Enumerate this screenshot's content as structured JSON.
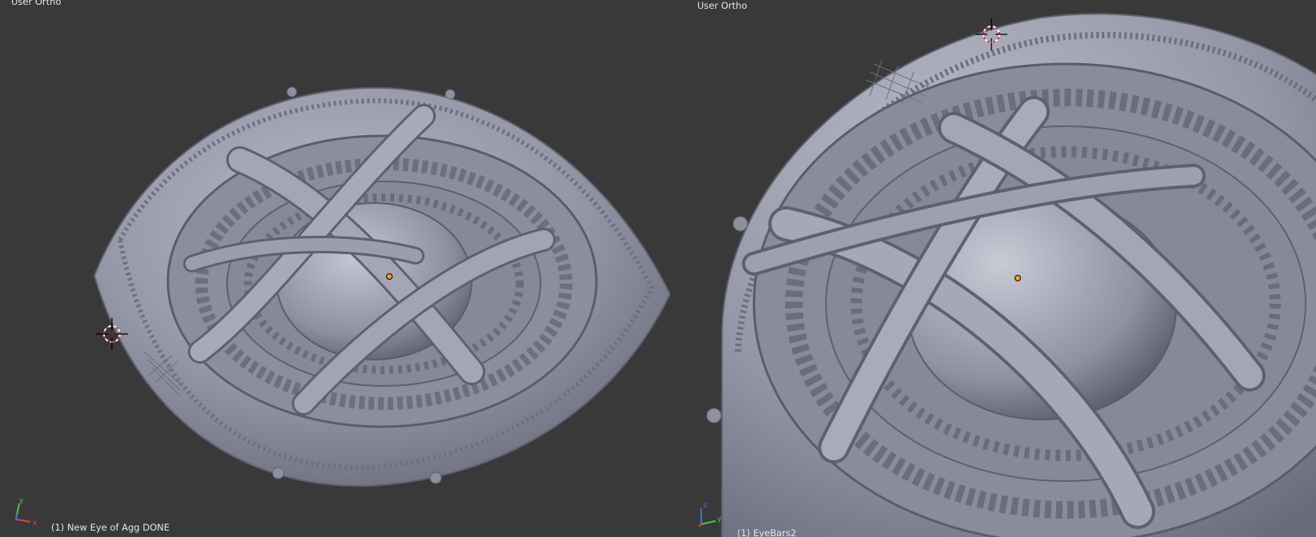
{
  "viewports": [
    {
      "view_label": "User Ortho",
      "object_label": "(1) New Eye of Agg DONE",
      "axes": [
        "x",
        "y"
      ]
    },
    {
      "view_label": "User Ortho",
      "object_label": "(1) EyeBars2",
      "axes": [
        "y",
        "z"
      ]
    }
  ],
  "colors": {
    "background": "#393939",
    "mesh_base": "#9597a8",
    "mesh_light": "#b7b9c8",
    "mesh_dark": "#5f6170",
    "axis_x": "#d7463c",
    "axis_y": "#4fc44a",
    "axis_z": "#3e6ee0",
    "origin_dot": "#f0a030"
  },
  "icons": [
    "3d-cursor-icon",
    "axis-gizmo-icon",
    "object-origin-icon"
  ]
}
